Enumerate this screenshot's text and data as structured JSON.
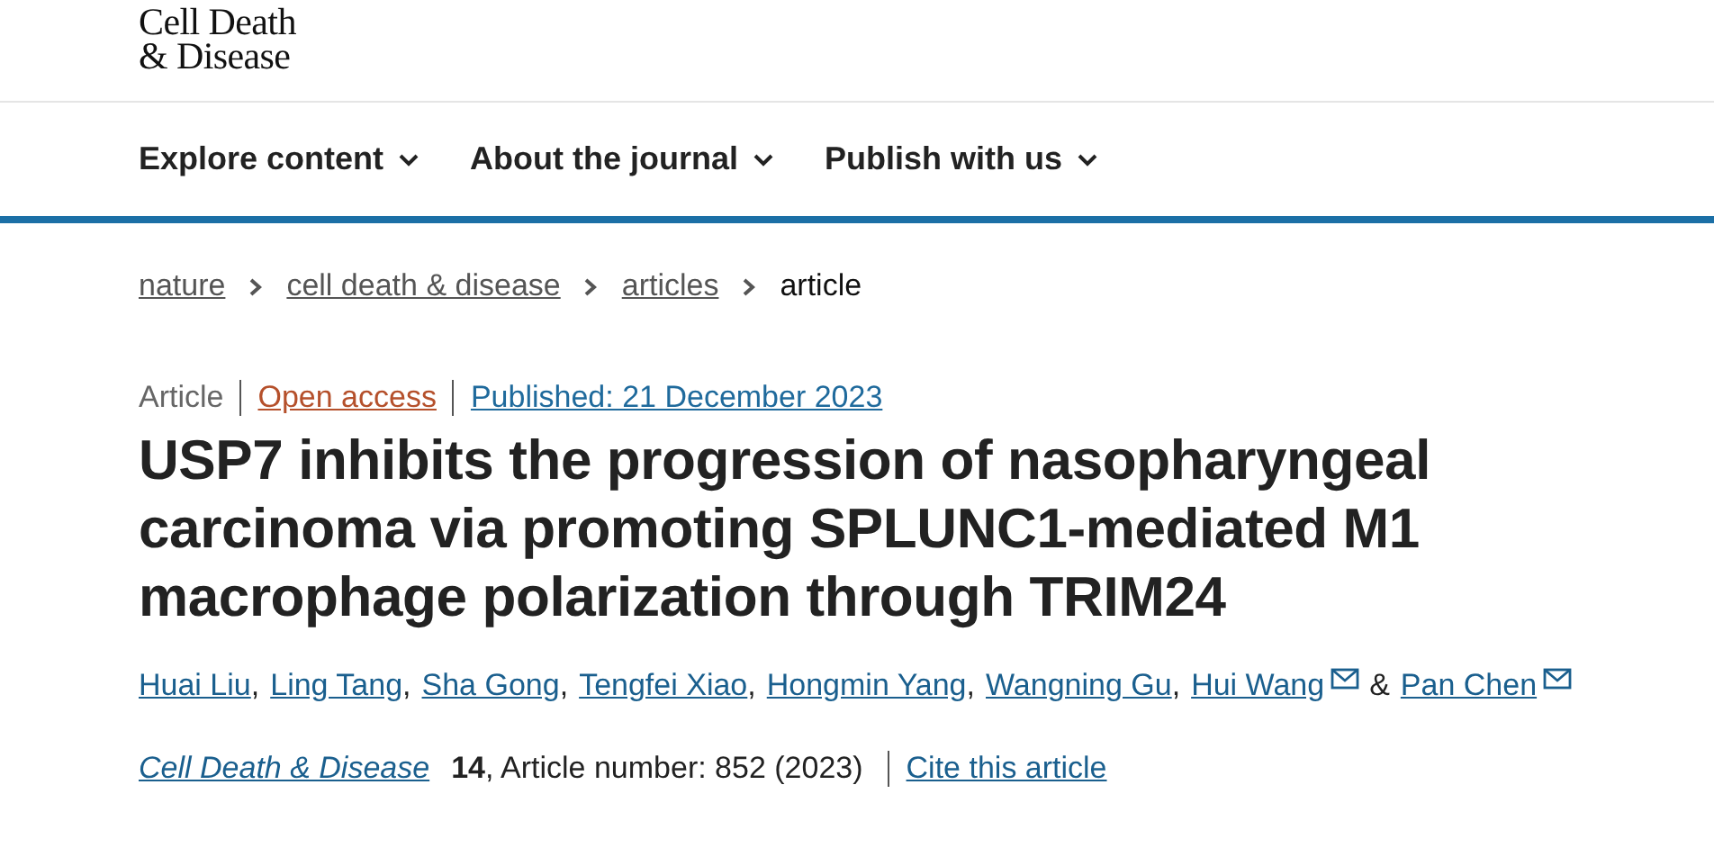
{
  "header": {
    "logo_lines": [
      "Cell Death",
      "& Disease"
    ]
  },
  "nav": [
    {
      "label": "Explore content"
    },
    {
      "label": "About the journal"
    },
    {
      "label": "Publish with us"
    }
  ],
  "breadcrumbs": [
    {
      "label": "nature",
      "link": true
    },
    {
      "label": "cell death & disease",
      "link": true
    },
    {
      "label": "articles",
      "link": true
    },
    {
      "label": "article",
      "link": false
    }
  ],
  "meta": [
    {
      "kind": "type",
      "text": "Article"
    },
    {
      "kind": "access",
      "text": "Open access"
    },
    {
      "kind": "date",
      "text": "Published: 21 December 2023"
    }
  ],
  "title": "USP7 inhibits the progression of nasopharyngeal carcinoma via promoting SPLUNC1-mediated M1 macrophage polarization through TRIM24",
  "authors": [
    {
      "name": "Huai Liu",
      "separator": ","
    },
    {
      "name": "Ling Tang",
      "separator": ","
    },
    {
      "name": "Sha Gong",
      "separator": ","
    },
    {
      "name": "Tengfei Xiao",
      "separator": ","
    },
    {
      "name": "Hongmin Yang",
      "separator": ","
    },
    {
      "name": "Wangning Gu",
      "separator": ","
    },
    {
      "name": "Hui Wang",
      "email": true,
      "separator": "&"
    },
    {
      "name": "Pan Chen",
      "email": true
    }
  ],
  "citation": {
    "journal": "Cell Death & Disease",
    "details": "**14**, Article number: 852 (2023)",
    "cite_link": "Cite this article"
  }
}
